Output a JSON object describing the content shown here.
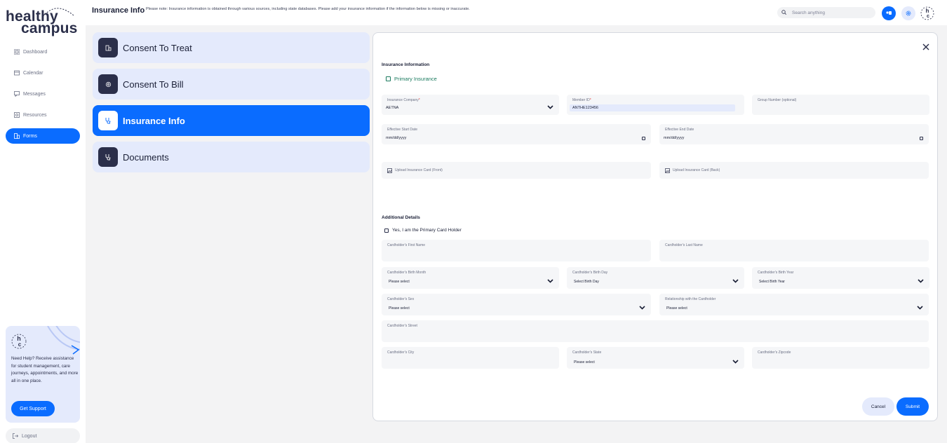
{
  "app": {
    "logo_line1": "healthy",
    "logo_line2": "campus",
    "logo_badge": "hc"
  },
  "sidebar": {
    "items": [
      {
        "label": "Dashboard",
        "icon": "grid-icon",
        "active": false
      },
      {
        "label": "Calendar",
        "icon": "calendar-icon",
        "active": false
      },
      {
        "label": "Messages",
        "icon": "message-icon",
        "active": false
      },
      {
        "label": "Resources",
        "icon": "resources-icon",
        "active": false
      },
      {
        "label": "Forms",
        "icon": "forms-icon",
        "active": true
      }
    ],
    "help": {
      "text": "Need Help? Receive assistance for student management, care journeys, appointments, and more all in one place.",
      "button": "Get Support"
    },
    "logout": "Logout"
  },
  "header": {
    "title": "Insurance Info",
    "note": "Please note: Insurance information is obtained through various sources, including state databases. Please add your insurance information if the information below is missing or inaccurate.",
    "search_placeholder": "Search anything"
  },
  "steps": [
    {
      "label": "Consent To Treat",
      "icon": "building-icon",
      "active": false
    },
    {
      "label": "Consent To Bill",
      "icon": "billing-icon",
      "active": false
    },
    {
      "label": "Insurance Info",
      "icon": "stethoscope-icon",
      "active": true
    },
    {
      "label": "Documents",
      "icon": "stethoscope-icon",
      "active": false
    }
  ],
  "form": {
    "insurance_title": "Insurance Information",
    "primary_insurance": "Primary Insurance",
    "insurance_company": {
      "label": "Insurance Company",
      "value": "AETNA"
    },
    "member_id": {
      "label": "Member ID",
      "value": "ANTHE123456"
    },
    "group_number": {
      "label": "Group Number (optional)"
    },
    "effective_start": {
      "label": "Effective Start Date",
      "value": "mm/dd/yyyy"
    },
    "effective_end": {
      "label": "Effective End Date",
      "value": "mm/dd/yyyy"
    },
    "upload_front": "Upload Insurance Card (Front)",
    "upload_back": "Upload Insurance Card (Back)",
    "additional_title": "Additional Details",
    "primary_holder": "Yes, I am the Primary Card Holder",
    "first_name": {
      "label": "Cardholder's First Name"
    },
    "last_name": {
      "label": "Cardholder's Last Name"
    },
    "birth_month": {
      "label": "Cardholder's Birth Month",
      "value": "Please select"
    },
    "birth_day": {
      "label": "Cardholder's Birth Day",
      "value": "Select Birth Day"
    },
    "birth_year": {
      "label": "Cardholder's Birth Year",
      "value": "Select Birth Year"
    },
    "sex": {
      "label": "Cardholder's Sex",
      "value": "Please select"
    },
    "relationship": {
      "label": "Relationship with the Cardholder",
      "value": "Please select"
    },
    "street": {
      "label": "Cardholder's Street"
    },
    "city": {
      "label": "Cardholder's City"
    },
    "state": {
      "label": "Cardholder's State",
      "value": "Please select"
    },
    "zipcode": {
      "label": "Cardholder's Zipcode"
    },
    "cancel": "Cancel",
    "submit": "Submit"
  },
  "colors": {
    "accent": "#0a6cff",
    "dark": "#2b2f4a",
    "soft": "#e4eafc",
    "primary_check": "#1a7a5e"
  }
}
